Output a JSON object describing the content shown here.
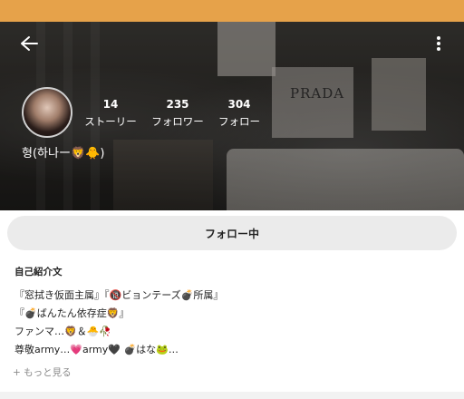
{
  "profile": {
    "username": "형(하나ー🦁🐥)",
    "stats": [
      {
        "value": "14",
        "label": "ストーリー"
      },
      {
        "value": "235",
        "label": "フォロワー"
      },
      {
        "value": "304",
        "label": "フォロー"
      }
    ],
    "poster_text": "PRADA"
  },
  "actions": {
    "follow_label": "フォロー中"
  },
  "bio": {
    "title": "自己紹介文",
    "lines": [
      "『窓拭き仮面主属』『🔞ビョンテーズ💣所属』",
      "『💣ばんたん依存症🦁』",
      "ファンマ…🦁＆🐣🥀",
      "尊敬army…💗army🖤 💣はな🐸…"
    ],
    "more_label": "+ もっと見る"
  },
  "icons": {
    "back": "arrow-left-icon",
    "more": "more-vertical-icon"
  },
  "colors": {
    "top_strip": "#e6a24a",
    "button_bg": "#ebebeb"
  }
}
